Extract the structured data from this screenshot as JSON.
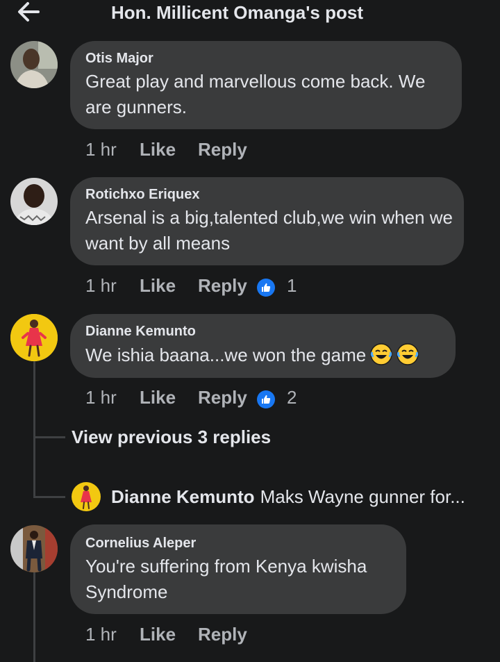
{
  "header": {
    "title": "Hon. Millicent Omanga's post",
    "back_icon": "arrow-left-icon"
  },
  "comments": [
    {
      "author": "Otis Major",
      "text": "Great play and marvellous come back. We are gunners.",
      "time": "1 hr",
      "like": "Like",
      "reply": "Reply",
      "reactions": null
    },
    {
      "author": "Rotichxo Eriquex",
      "text": "Arsenal is a big,talented club,we win when we want by all means",
      "time": "1 hr",
      "like": "Like",
      "reply": "Reply",
      "reactions": "1"
    },
    {
      "author": "Dianne Kemunto",
      "text": "We ishia baana...we won the game",
      "time": "1 hr",
      "like": "Like",
      "reply": "Reply",
      "reactions": "2"
    },
    {
      "author": "Cornelius Aleper",
      "text": "You're suffering from Kenya kwisha Syndrome",
      "time": "1 hr",
      "like": "Like",
      "reply": "Reply",
      "reactions": null
    }
  ],
  "thread": {
    "view_previous": "View previous 3 replies",
    "reply_author": "Dianne Kemunto",
    "reply_text": "Maks Wayne gunner for..."
  },
  "colors": {
    "background": "#18191a",
    "bubble": "#3a3b3c",
    "muted": "#b0b3b8",
    "like_blue": "#1877f2"
  }
}
